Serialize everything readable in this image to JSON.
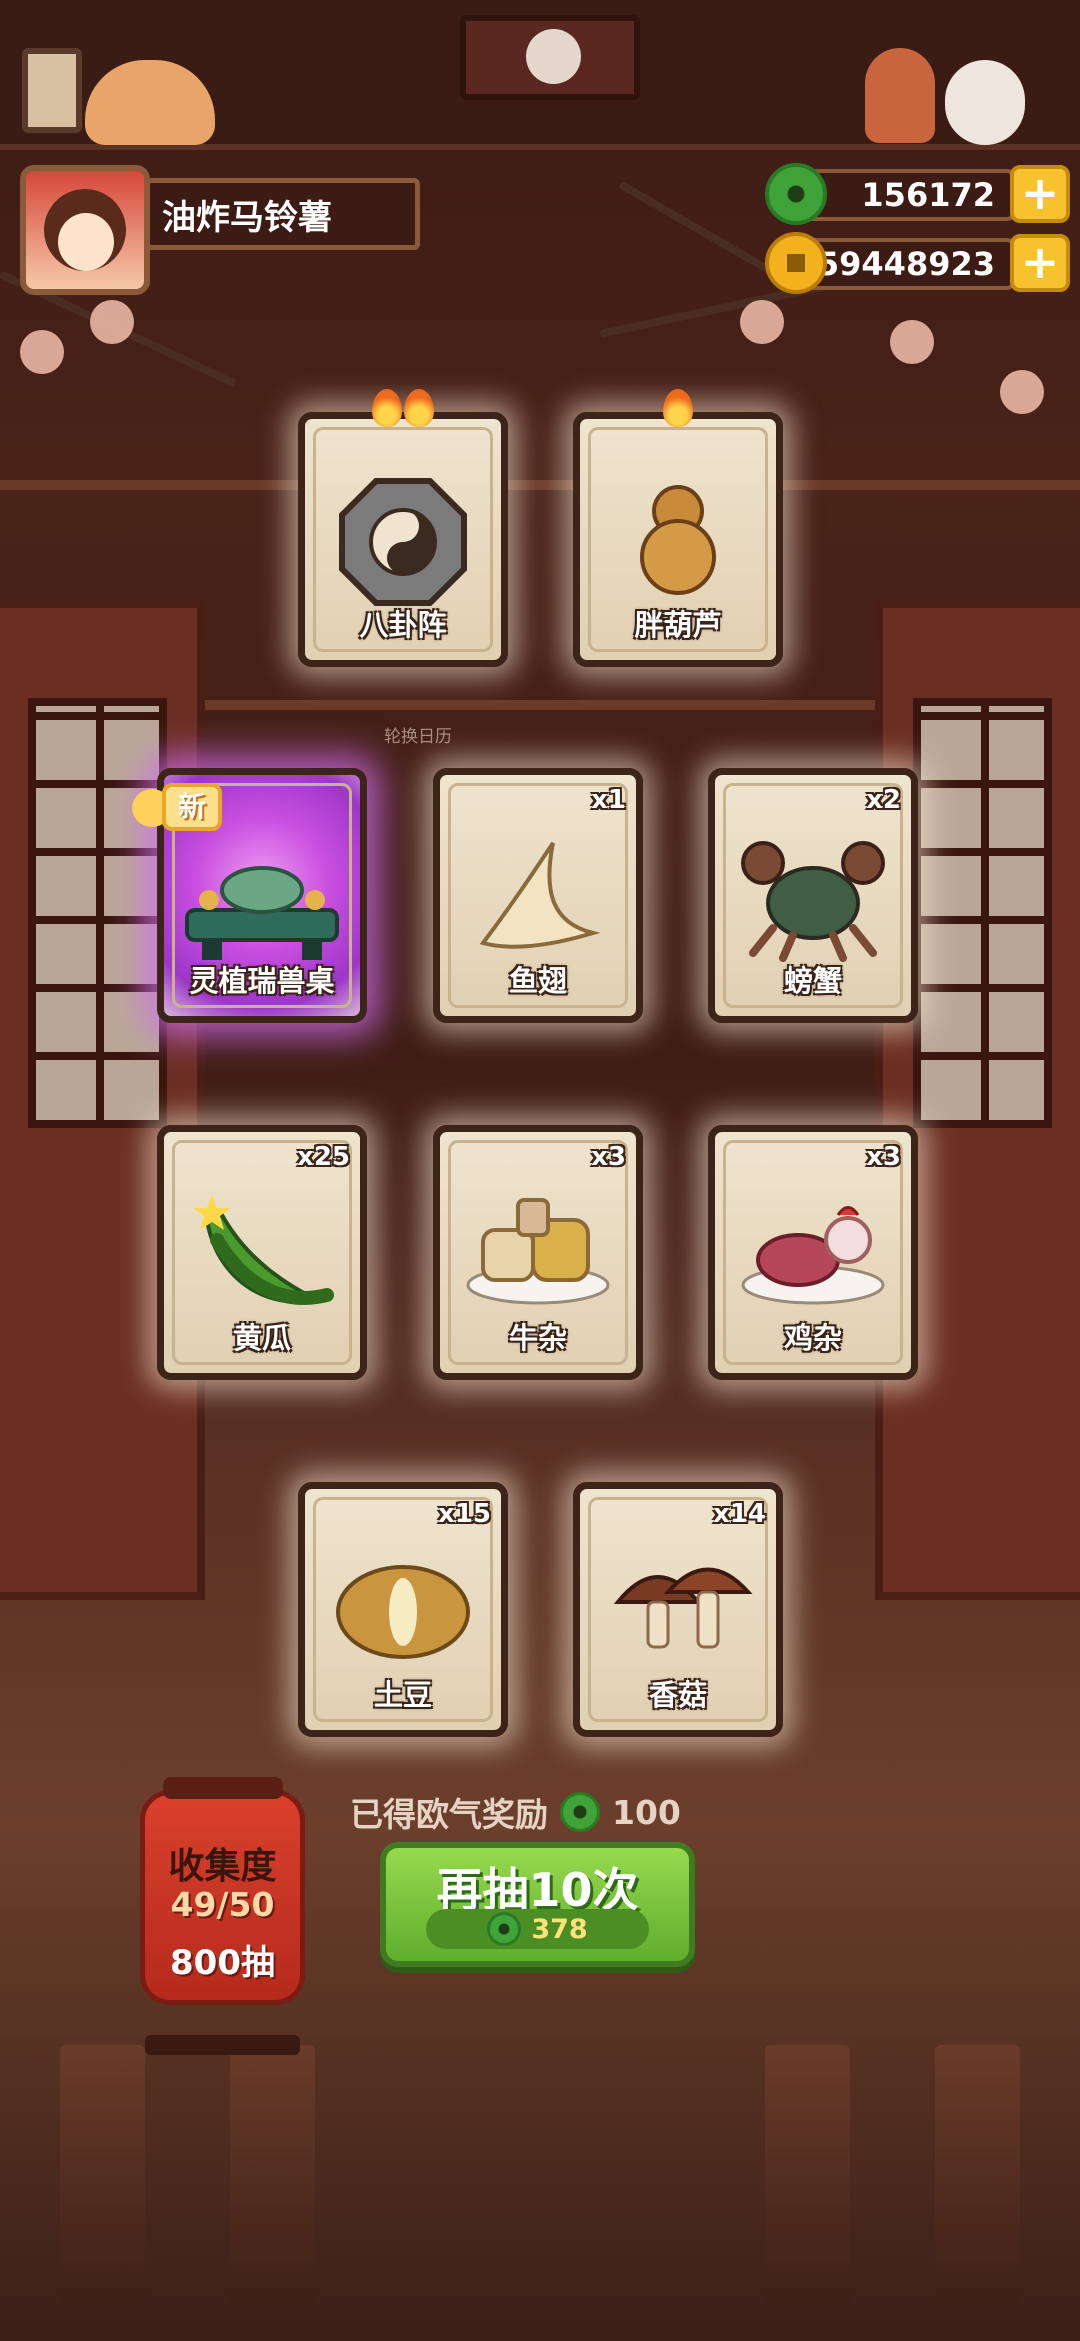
{
  "player": {
    "name": "油炸马铃薯"
  },
  "currency": {
    "jade": "156172",
    "coins": "59448923"
  },
  "calendar_hint": "轮换日历",
  "cards": [
    {
      "label": "八卦阵",
      "count": "",
      "flames": 2,
      "art": "bagua-icon",
      "rare": false,
      "new": false
    },
    {
      "label": "胖葫芦",
      "count": "",
      "flames": 1,
      "art": "gourd-icon",
      "rare": false,
      "new": false
    },
    {
      "label": "灵植瑞兽桌",
      "count": "",
      "flames": 0,
      "art": "beast-table-icon",
      "rare": true,
      "new": true
    },
    {
      "label": "鱼翅",
      "count": "x1",
      "flames": 0,
      "art": "shark-fin-icon",
      "rare": false,
      "new": false
    },
    {
      "label": "螃蟹",
      "count": "x2",
      "flames": 0,
      "art": "crab-icon",
      "rare": false,
      "new": false
    },
    {
      "label": "黄瓜",
      "count": "x25",
      "flames": 0,
      "art": "cucumber-icon",
      "rare": false,
      "new": false
    },
    {
      "label": "牛杂",
      "count": "x3",
      "flames": 0,
      "art": "beef-offal-icon",
      "rare": false,
      "new": false
    },
    {
      "label": "鸡杂",
      "count": "x3",
      "flames": 0,
      "art": "chicken-offal-icon",
      "rare": false,
      "new": false
    },
    {
      "label": "土豆",
      "count": "x15",
      "flames": 0,
      "art": "potato-icon",
      "rare": false,
      "new": false
    },
    {
      "label": "香菇",
      "count": "x14",
      "flames": 0,
      "art": "mushroom-icon",
      "rare": false,
      "new": false
    }
  ],
  "new_badge": "新",
  "collection": {
    "title": "收集度",
    "progress": "49/50",
    "draws": "800抽"
  },
  "reward": {
    "label": "已得欧气奖励",
    "amount": "100"
  },
  "draw_button": {
    "label": "再抽10次",
    "cost": "378"
  },
  "colors": {
    "jade_green": "#3fa33a",
    "coin_gold": "#f3b11d",
    "button_green": "#7cc43e",
    "rare_purple": "#c94fe0"
  }
}
